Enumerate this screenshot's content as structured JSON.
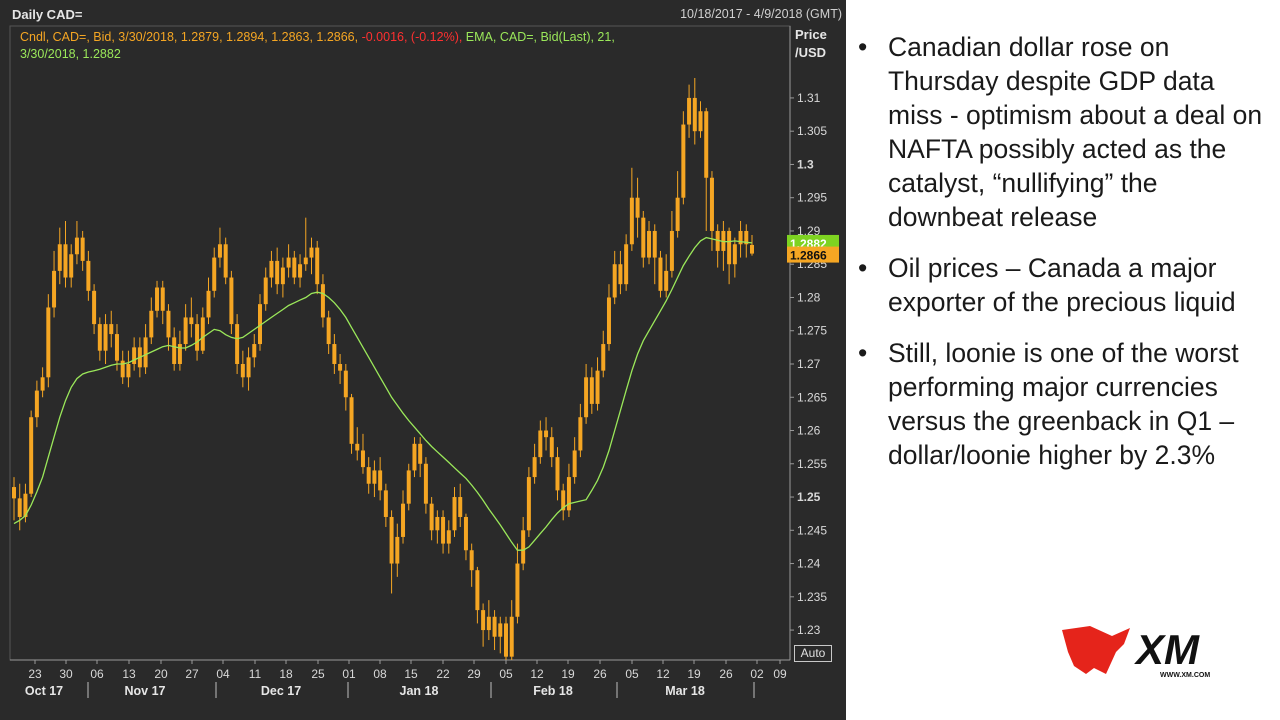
{
  "chart_header": {
    "title": "Daily CAD=",
    "date_range": "10/18/2017 - 4/9/2018 (GMT)",
    "legend_line1_orange": "Cndl, CAD=, Bid, 3/30/2018, 1.2879, 1.2894, 1.2863, 1.2866,",
    "legend_line1_red": " -0.0016, (-0.12%),",
    "legend_line1_green": " EMA, CAD=, Bid(Last),  21,",
    "legend_line2_green": "3/30/2018, 1.2882",
    "price_unit_line1": "Price",
    "price_unit_line2": "/USD",
    "auto_button": "Auto"
  },
  "colors": {
    "background": "#2a2a2a",
    "candle": "#f5a623",
    "ema": "#9be85a",
    "down_text": "#ff3030",
    "axis_text": "#d8d8d8"
  },
  "chart_data": {
    "type": "candlestick",
    "title": "Daily CAD=",
    "ylim": [
      1.2255,
      1.3145
    ],
    "y_ticks": [
      1.31,
      1.305,
      1.3,
      1.295,
      1.29,
      1.285,
      1.28,
      1.275,
      1.27,
      1.265,
      1.26,
      1.255,
      1.25,
      1.245,
      1.24,
      1.235,
      1.23
    ],
    "y_tick_labels": [
      "1.31",
      "1.305",
      "1.3",
      "1.295",
      "1.29",
      "1.285",
      "1.28",
      "1.275",
      "1.27",
      "1.265",
      "1.26",
      "1.255",
      "1.25",
      "1.245",
      "1.24",
      "1.235",
      "1.23"
    ],
    "bold_ticks": [
      "1.3",
      "1.25"
    ],
    "x_day_ticks": [
      "23",
      "30",
      "06",
      "13",
      "20",
      "27",
      "04",
      "11",
      "18",
      "25",
      "01",
      "08",
      "15",
      "22",
      "29",
      "05",
      "12",
      "19",
      "26",
      "05",
      "12",
      "19",
      "26",
      "02",
      "09"
    ],
    "x_month_labels": [
      "Oct 17",
      "Nov 17",
      "Dec 17",
      "Jan 18",
      "Feb 18",
      "Mar 18"
    ],
    "last_close_label": "1.2866",
    "last_ema_label": "1.2882",
    "last_close": 1.2866,
    "last_ema": 1.2882,
    "grid": false,
    "series": [
      {
        "name": "Cndl, CAD=, Bid",
        "kind": "ohlc",
        "candles": [
          [
            1.2515,
            1.2498,
            1.253,
            1.2465
          ],
          [
            1.2498,
            1.247,
            1.252,
            1.245
          ],
          [
            1.247,
            1.2505,
            1.252,
            1.2462
          ],
          [
            1.2505,
            1.262,
            1.263,
            1.25
          ],
          [
            1.262,
            1.266,
            1.2675,
            1.2605
          ],
          [
            1.266,
            1.268,
            1.2695,
            1.265
          ],
          [
            1.268,
            1.2785,
            1.2805,
            1.2665
          ],
          [
            1.2785,
            1.284,
            1.287,
            1.277
          ],
          [
            1.284,
            1.288,
            1.2905,
            1.282
          ],
          [
            1.288,
            1.283,
            1.2915,
            1.2815
          ],
          [
            1.283,
            1.2865,
            1.288,
            1.2815
          ],
          [
            1.2865,
            1.289,
            1.2915,
            1.285
          ],
          [
            1.289,
            1.2855,
            1.29,
            1.284
          ],
          [
            1.2855,
            1.281,
            1.287,
            1.2795
          ],
          [
            1.281,
            1.276,
            1.282,
            1.2745
          ],
          [
            1.276,
            1.272,
            1.277,
            1.2705
          ],
          [
            1.272,
            1.276,
            1.2775,
            1.27
          ],
          [
            1.276,
            1.2745,
            1.278,
            1.2725
          ],
          [
            1.2745,
            1.2705,
            1.276,
            1.269
          ],
          [
            1.2705,
            1.268,
            1.272,
            1.267
          ],
          [
            1.268,
            1.27,
            1.272,
            1.2665
          ],
          [
            1.27,
            1.2725,
            1.274,
            1.269
          ],
          [
            1.2725,
            1.2695,
            1.274,
            1.268
          ],
          [
            1.2695,
            1.274,
            1.276,
            1.2685
          ],
          [
            1.274,
            1.278,
            1.28,
            1.273
          ],
          [
            1.278,
            1.2815,
            1.2825,
            1.277
          ],
          [
            1.2815,
            1.278,
            1.2825,
            1.276
          ],
          [
            1.278,
            1.274,
            1.279,
            1.272
          ],
          [
            1.274,
            1.27,
            1.2755,
            1.269
          ],
          [
            1.27,
            1.273,
            1.275,
            1.269
          ],
          [
            1.273,
            1.277,
            1.279,
            1.272
          ],
          [
            1.277,
            1.276,
            1.28,
            1.274
          ],
          [
            1.276,
            1.272,
            1.2775,
            1.2705
          ],
          [
            1.272,
            1.277,
            1.2785,
            1.2715
          ],
          [
            1.277,
            1.281,
            1.283,
            1.276
          ],
          [
            1.281,
            1.286,
            1.2875,
            1.28
          ],
          [
            1.286,
            1.288,
            1.2905,
            1.2845
          ],
          [
            1.288,
            1.283,
            1.289,
            1.282
          ],
          [
            1.283,
            1.276,
            1.284,
            1.2745
          ],
          [
            1.276,
            1.27,
            1.2775,
            1.2685
          ],
          [
            1.27,
            1.268,
            1.272,
            1.2665
          ],
          [
            1.268,
            1.271,
            1.2725,
            1.266
          ],
          [
            1.271,
            1.273,
            1.2745,
            1.2695
          ],
          [
            1.273,
            1.279,
            1.2805,
            1.272
          ],
          [
            1.279,
            1.283,
            1.2845,
            1.278
          ],
          [
            1.283,
            1.2855,
            1.287,
            1.2815
          ],
          [
            1.2855,
            1.282,
            1.2875,
            1.2805
          ],
          [
            1.282,
            1.2845,
            1.286,
            1.28
          ],
          [
            1.2845,
            1.286,
            1.288,
            1.283
          ],
          [
            1.286,
            1.283,
            1.287,
            1.282
          ],
          [
            1.283,
            1.285,
            1.2865,
            1.2815
          ],
          [
            1.285,
            1.286,
            1.292,
            1.284
          ],
          [
            1.286,
            1.2875,
            1.289,
            1.2835
          ],
          [
            1.2875,
            1.282,
            1.2885,
            1.2805
          ],
          [
            1.282,
            1.277,
            1.2835,
            1.2755
          ],
          [
            1.277,
            1.273,
            1.278,
            1.2715
          ],
          [
            1.273,
            1.27,
            1.2745,
            1.2685
          ],
          [
            1.27,
            1.269,
            1.2715,
            1.267
          ],
          [
            1.269,
            1.265,
            1.27,
            1.263
          ],
          [
            1.265,
            1.258,
            1.2655,
            1.2565
          ],
          [
            1.258,
            1.257,
            1.2605,
            1.2555
          ],
          [
            1.257,
            1.2545,
            1.2595,
            1.2535
          ],
          [
            1.2545,
            1.252,
            1.256,
            1.2505
          ],
          [
            1.252,
            1.254,
            1.2555,
            1.25
          ],
          [
            1.254,
            1.251,
            1.256,
            1.2495
          ],
          [
            1.251,
            1.247,
            1.252,
            1.2455
          ],
          [
            1.247,
            1.24,
            1.248,
            1.2355
          ],
          [
            1.24,
            1.244,
            1.246,
            1.238
          ],
          [
            1.244,
            1.249,
            1.251,
            1.243
          ],
          [
            1.249,
            1.254,
            1.255,
            1.248
          ],
          [
            1.254,
            1.258,
            1.259,
            1.253
          ],
          [
            1.258,
            1.255,
            1.259,
            1.253
          ],
          [
            1.255,
            1.249,
            1.256,
            1.2475
          ],
          [
            1.249,
            1.245,
            1.25,
            1.2435
          ],
          [
            1.245,
            1.247,
            1.248,
            1.243
          ],
          [
            1.247,
            1.243,
            1.248,
            1.2415
          ],
          [
            1.243,
            1.245,
            1.2465,
            1.2415
          ],
          [
            1.245,
            1.25,
            1.2515,
            1.244
          ],
          [
            1.25,
            1.247,
            1.252,
            1.2455
          ],
          [
            1.247,
            1.242,
            1.2475,
            1.2405
          ],
          [
            1.242,
            1.239,
            1.243,
            1.2365
          ],
          [
            1.239,
            1.233,
            1.2395,
            1.231
          ],
          [
            1.233,
            1.23,
            1.234,
            1.2275
          ],
          [
            1.23,
            1.232,
            1.2345,
            1.2285
          ],
          [
            1.232,
            1.229,
            1.233,
            1.227
          ],
          [
            1.229,
            1.231,
            1.232,
            1.2265
          ],
          [
            1.231,
            1.226,
            1.232,
            1.225
          ],
          [
            1.226,
            1.232,
            1.2345,
            1.2255
          ],
          [
            1.232,
            1.24,
            1.243,
            1.231
          ],
          [
            1.24,
            1.245,
            1.247,
            1.239
          ],
          [
            1.245,
            1.253,
            1.2545,
            1.244
          ],
          [
            1.253,
            1.256,
            1.258,
            1.252
          ],
          [
            1.256,
            1.26,
            1.2615,
            1.255
          ],
          [
            1.26,
            1.259,
            1.262,
            1.257
          ],
          [
            1.259,
            1.256,
            1.2605,
            1.2545
          ],
          [
            1.256,
            1.251,
            1.2575,
            1.2495
          ],
          [
            1.251,
            1.248,
            1.252,
            1.2465
          ],
          [
            1.248,
            1.253,
            1.255,
            1.247
          ],
          [
            1.253,
            1.257,
            1.259,
            1.252
          ],
          [
            1.257,
            1.262,
            1.264,
            1.256
          ],
          [
            1.262,
            1.268,
            1.27,
            1.261
          ],
          [
            1.268,
            1.264,
            1.2695,
            1.2625
          ],
          [
            1.264,
            1.269,
            1.271,
            1.263
          ],
          [
            1.269,
            1.273,
            1.275,
            1.268
          ],
          [
            1.273,
            1.28,
            1.282,
            1.272
          ],
          [
            1.28,
            1.285,
            1.287,
            1.279
          ],
          [
            1.285,
            1.282,
            1.287,
            1.2805
          ],
          [
            1.282,
            1.288,
            1.2895,
            1.281
          ],
          [
            1.288,
            1.295,
            1.2995,
            1.287
          ],
          [
            1.295,
            1.292,
            1.298,
            1.289
          ],
          [
            1.292,
            1.286,
            1.293,
            1.2845
          ],
          [
            1.286,
            1.29,
            1.2915,
            1.285
          ],
          [
            1.29,
            1.286,
            1.291,
            1.282
          ],
          [
            1.286,
            1.281,
            1.287,
            1.28
          ],
          [
            1.281,
            1.284,
            1.2865,
            1.28
          ],
          [
            1.284,
            1.29,
            1.293,
            1.283
          ],
          [
            1.29,
            1.295,
            1.299,
            1.289
          ],
          [
            1.295,
            1.306,
            1.308,
            1.294
          ],
          [
            1.306,
            1.31,
            1.312,
            1.304
          ],
          [
            1.31,
            1.305,
            1.313,
            1.303
          ],
          [
            1.305,
            1.308,
            1.3095,
            1.304
          ],
          [
            1.308,
            1.298,
            1.3085,
            1.29
          ],
          [
            1.298,
            1.29,
            1.299,
            1.287
          ],
          [
            1.29,
            1.287,
            1.291,
            1.2845
          ],
          [
            1.287,
            1.29,
            1.2915,
            1.284
          ],
          [
            1.29,
            1.285,
            1.2905,
            1.282
          ],
          [
            1.285,
            1.288,
            1.289,
            1.283
          ],
          [
            1.288,
            1.29,
            1.2915,
            1.286
          ],
          [
            1.29,
            1.288,
            1.291,
            1.286
          ],
          [
            1.2879,
            1.2866,
            1.2894,
            1.2863
          ]
        ]
      },
      {
        "name": "EMA, CAD=, Bid(Last), 21",
        "kind": "line",
        "values": [
          1.246,
          1.2465,
          1.2472,
          1.2488,
          1.2508,
          1.253,
          1.256,
          1.259,
          1.262,
          1.2645,
          1.2665,
          1.2678,
          1.2685,
          1.2688,
          1.269,
          1.2692,
          1.2695,
          1.2698,
          1.27,
          1.27,
          1.2702,
          1.2706,
          1.271,
          1.2714,
          1.2718,
          1.2722,
          1.2726,
          1.2728,
          1.2726,
          1.2724,
          1.2724,
          1.2728,
          1.2733,
          1.274,
          1.2746,
          1.2752,
          1.275,
          1.2744,
          1.274,
          1.2738,
          1.274,
          1.2746,
          1.2752,
          1.2758,
          1.2764,
          1.277,
          1.2776,
          1.2782,
          1.2788,
          1.2792,
          1.2796,
          1.28,
          1.2806,
          1.2808,
          1.2806,
          1.28,
          1.2792,
          1.2782,
          1.277,
          1.2755,
          1.274,
          1.2725,
          1.271,
          1.2695,
          1.268,
          1.2665,
          1.265,
          1.2638,
          1.2626,
          1.2615,
          1.2605,
          1.2595,
          1.2585,
          1.2576,
          1.2568,
          1.256,
          1.2552,
          1.2544,
          1.2536,
          1.2528,
          1.2518,
          1.2507,
          1.2495,
          1.2482,
          1.247,
          1.2458,
          1.2445,
          1.2432,
          1.242,
          1.242,
          1.2425,
          1.2435,
          1.2445,
          1.2455,
          1.2466,
          1.2476,
          1.2484,
          1.249,
          1.2492,
          1.2494,
          1.2496,
          1.251,
          1.2525,
          1.2545,
          1.257,
          1.26,
          1.263,
          1.266,
          1.269,
          1.2715,
          1.2735,
          1.275,
          1.2765,
          1.278,
          1.2795,
          1.2812,
          1.283,
          1.2848,
          1.2862,
          1.2875,
          1.2885,
          1.289,
          1.2888,
          1.2886,
          1.2884,
          1.2884,
          1.2885,
          1.2884,
          1.2883,
          1.2882
        ]
      }
    ]
  },
  "bullets": [
    "Canadian dollar rose on Thursday despite GDP data miss - optimism about a deal on NAFTA possibly acted as the catalyst, “nullifying” the downbeat release",
    "Oil prices – Canada a major exporter of the precious liquid",
    "Still, loonie is one of the worst performing major currencies versus the greenback in Q1 – dollar/loonie higher by 2.3%"
  ],
  "bullet_glyph": "•",
  "logo": {
    "text": "XM",
    "url_text": "WWW.XM.COM"
  }
}
